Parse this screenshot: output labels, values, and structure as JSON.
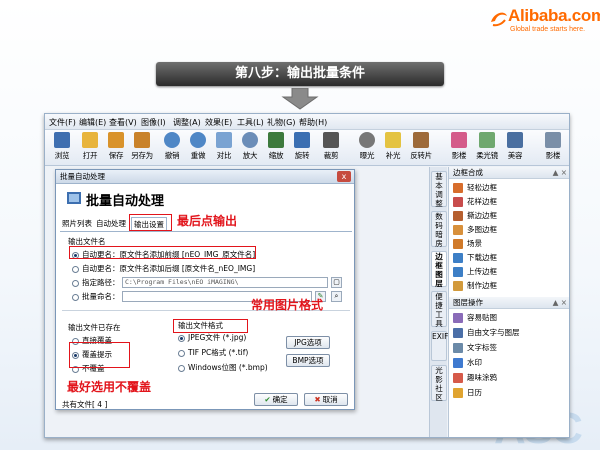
{
  "logo": {
    "brand": "Alibaba.com",
    "tagline": "Global trade starts here."
  },
  "step_title": "第八步：输出批量条件",
  "deco_text": "ASC",
  "menu": [
    "文件(F)",
    "编辑(E)",
    "查看(V)",
    "图像(I)",
    "调整(A)",
    "效果(E)",
    "工具(L)",
    "礼物(G)",
    "帮助(H)"
  ],
  "toolbar": [
    {
      "label": "浏览",
      "icon": "browse-icon"
    },
    {
      "label": "打开",
      "icon": "folder-open-icon"
    },
    {
      "label": "保存",
      "icon": "save-icon"
    },
    {
      "label": "另存为",
      "icon": "save-as-icon"
    },
    {
      "label": "撤销",
      "icon": "undo-icon"
    },
    {
      "label": "重做",
      "icon": "redo-icon"
    },
    {
      "label": "对比",
      "icon": "compare-icon"
    },
    {
      "label": "放大",
      "icon": "zoom-in-icon"
    },
    {
      "label": "缩放",
      "icon": "resize-icon"
    },
    {
      "label": "旋转",
      "icon": "rotate-icon"
    },
    {
      "label": "裁剪",
      "icon": "crop-icon"
    },
    {
      "label": "曝光",
      "icon": "exposure-icon"
    },
    {
      "label": "补光",
      "icon": "fill-light-icon"
    },
    {
      "label": "反转片",
      "icon": "reversal-film-icon"
    },
    {
      "label": "影楼",
      "icon": "studio-icon"
    },
    {
      "label": "柔光镜",
      "icon": "soft-light-icon"
    },
    {
      "label": "美容",
      "icon": "beauty-icon"
    },
    {
      "label": "影楼",
      "icon": "studio2-icon"
    }
  ],
  "vtabs": [
    "基本调整",
    "数码暗房",
    "边框图层",
    "便捷工具",
    "EXIF",
    "光影社区"
  ],
  "right_panel": {
    "frame_header": "边框合成",
    "frame_items": [
      "轻松边框",
      "花样边框",
      "撕边边框",
      "多图边框",
      "场景",
      "下载边框",
      "上传边框",
      "制作边框"
    ],
    "layer_header": "图层操作",
    "layer_items": [
      "容易贴图",
      "自由文字与图层",
      "文字标签",
      "水印",
      "趣味涂鸦",
      "日历"
    ]
  },
  "dialog": {
    "window_title": "批量自动处理",
    "close": "x",
    "heading": "批量自动处理",
    "tabs": [
      "照片列表",
      "自动处理",
      "输出设置"
    ],
    "output_name_label": "输出文件名",
    "rename_options": [
      "自动更名：原文件名添加前缀 [nEO_IMG_原文件名]",
      "自动更名：原文件名添加后缀 [原文件名_nEO_IMG]",
      "指定路径：",
      "批量命名："
    ],
    "path_value": "C:\\Program Files\\nEO iMAGING\\",
    "exists_label": "输出文件已存在",
    "exists_options": [
      "直接覆盖",
      "覆盖提示",
      "不覆盖"
    ],
    "format_label": "输出文件格式",
    "format_options": [
      "JPEG文件 (*.jpg)",
      "TIF PC格式 (*.tif)",
      "Windows位图 (*.bmp)"
    ],
    "jpg_button": "JPG选项",
    "bmp_button": "BMP选项",
    "footer": "共有文件[ 4 ]",
    "ok": "确定",
    "cancel": "取消"
  },
  "annotations": {
    "last_output": "最后点输出",
    "common_format": "常用图片格式",
    "no_overwrite": "最好选用不覆盖"
  }
}
